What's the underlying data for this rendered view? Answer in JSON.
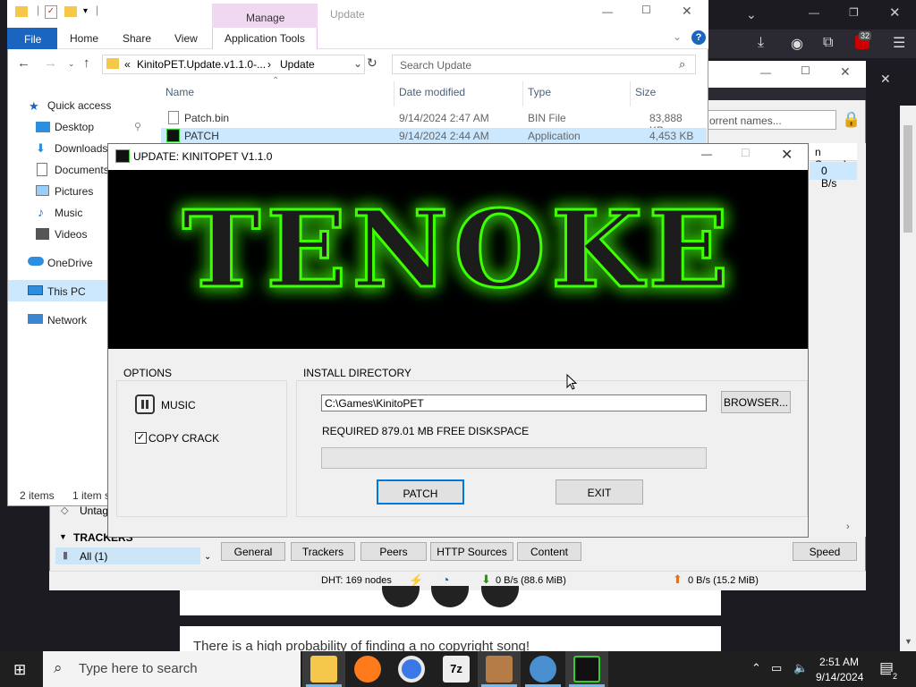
{
  "browser": {
    "ext_badge": "32",
    "page_text": "There is a high probability of finding a no copyright song!"
  },
  "qbittorrent": {
    "filter_placeholder": "orrent names...",
    "col_speed": "n Speed",
    "row_speed": "0 B/s",
    "side_untag": "Untag",
    "side_trackers": "TRACKERS",
    "side_all": "All (1)",
    "tabs": [
      "General",
      "Trackers",
      "Peers",
      "HTTP Sources",
      "Content"
    ],
    "speed_tab": "Speed",
    "status": {
      "dht": "DHT: 169 nodes",
      "down": "0 B/s (88.6 MiB)",
      "up": "0 B/s (15.2 MiB)"
    }
  },
  "explorer": {
    "ribbon": {
      "file": "File",
      "home": "Home",
      "share": "Share",
      "view": "View",
      "manage": "Manage",
      "app_tools": "Application Tools",
      "update_title": "Update"
    },
    "address": {
      "crumb_prefix": "«",
      "crumb1": "KinitoPET.Update.v1.1.0-...",
      "sep": "›",
      "crumb2": "Update"
    },
    "search_placeholder": "Search Update",
    "nav": {
      "quick_access": "Quick access",
      "desktop": "Desktop",
      "downloads": "Downloads",
      "documents": "Documents",
      "pictures": "Pictures",
      "music": "Music",
      "videos": "Videos",
      "onedrive": "OneDrive",
      "this_pc": "This PC",
      "network": "Network"
    },
    "columns": {
      "name": "Name",
      "date": "Date modified",
      "type": "Type",
      "size": "Size"
    },
    "files": [
      {
        "name": "Patch.bin",
        "date": "9/14/2024 2:47 AM",
        "type": "BIN File",
        "size": "83,888 KB"
      },
      {
        "name": "PATCH",
        "date": "9/14/2024 2:44 AM",
        "type": "Application",
        "size": "4,453 KB"
      }
    ],
    "status_items": "2 items",
    "status_selected": "1 item s"
  },
  "patcher": {
    "title": "UPDATE: KINITOPET V1.1.0",
    "banner_text": "TENOKE",
    "options_label": "OPTIONS",
    "music_label": "MUSIC",
    "copy_crack_label": "COPY CRACK",
    "copy_crack_checked": true,
    "install_dir_label": "INSTALL DIRECTORY",
    "install_path": "C:\\Games\\KinitoPET",
    "browse_label": "BROWSER...",
    "required_text": "REQUIRED 879.01 MB FREE DISKSPACE",
    "progress": 0,
    "patch_button": "PATCH",
    "exit_button": "EXIT"
  },
  "taskbar": {
    "search_placeholder": "Type here to search",
    "time": "2:51 AM",
    "date": "9/14/2024",
    "notification_count": "2"
  },
  "colors": {
    "accent_blue": "#1a65c0",
    "manage_pink": "#f0d8f3",
    "banner_green": "#3cff00"
  }
}
